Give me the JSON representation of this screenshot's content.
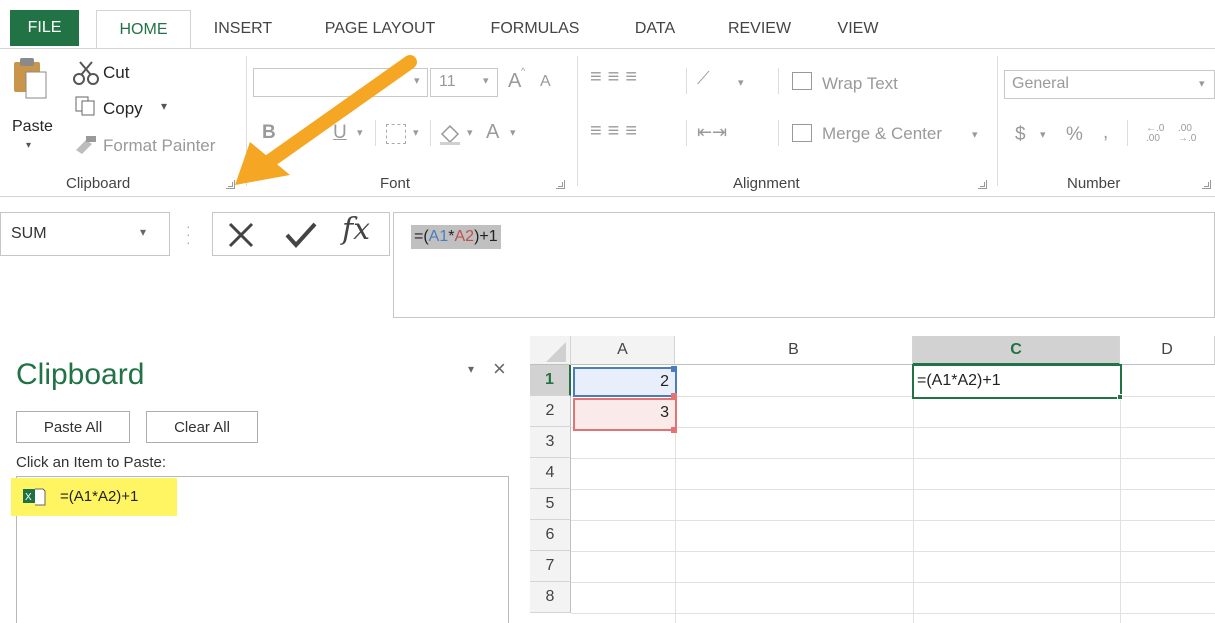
{
  "tabs": {
    "file": "FILE",
    "home": "HOME",
    "insert": "INSERT",
    "page_layout": "PAGE LAYOUT",
    "formulas": "FORMULAS",
    "data": "DATA",
    "review": "REVIEW",
    "view": "VIEW"
  },
  "clipboard_group": {
    "paste": "Paste",
    "cut": "Cut",
    "copy": "Copy",
    "format_painter": "Format Painter",
    "label": "Clipboard"
  },
  "font_group": {
    "font_size": "11",
    "bold": "B",
    "underline": "U",
    "font_color": "A",
    "grow": "A",
    "shrink": "A",
    "label": "Font"
  },
  "alignment_group": {
    "wrap_text": "Wrap Text",
    "merge_center": "Merge & Center",
    "label": "Alignment"
  },
  "number_group": {
    "format": "General",
    "currency": "$",
    "percent": "%",
    "comma": ",",
    "label": "Number"
  },
  "formula_bar": {
    "name_box": "SUM",
    "fx": "fx",
    "formula_parts": [
      "=(",
      "A1",
      "*",
      "A2",
      ")+1"
    ]
  },
  "clipboard_pane": {
    "title": "Clipboard",
    "paste_all": "Paste All",
    "clear_all": "Clear All",
    "instruction": "Click an Item to Paste:",
    "items": [
      "=(A1*A2)+1"
    ]
  },
  "sheet": {
    "columns": [
      "A",
      "B",
      "C",
      "D"
    ],
    "rows": [
      "1",
      "2",
      "3",
      "4",
      "5",
      "6",
      "7",
      "8"
    ],
    "A1": "2",
    "A2": "3",
    "C1": "=(A1*A2)+1"
  },
  "colors": {
    "excel_green": "#217346",
    "highlight": "#fff562",
    "arrow": "#f5a623",
    "ref_blue": "#4a7ebb",
    "ref_red": "#c0504d"
  }
}
